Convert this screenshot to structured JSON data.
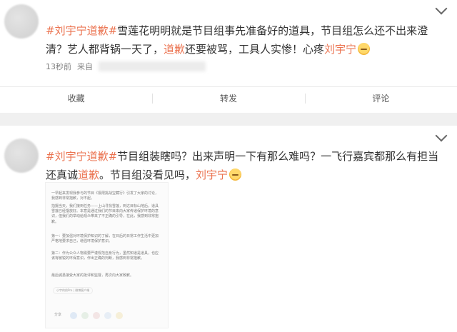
{
  "post1": {
    "text": [
      {
        "t": "#刘宇宁道歉#",
        "tag": true
      },
      {
        "t": "雪莲花明明就是节目组事先准备好的道具，节目组怎么还不出来澄清？艺人都背锅一天了，",
        "tag": false
      },
      {
        "t": "道歉",
        "tag": true
      },
      {
        "t": "还要被骂，工具人实惨！心疼",
        "tag": false
      },
      {
        "t": "刘宇宁",
        "tag": true
      }
    ],
    "time": "13秒前",
    "source_label": "来自",
    "actions": [
      "收藏",
      "转发",
      "评论"
    ]
  },
  "post2": {
    "text": [
      {
        "t": "#刘宇宁道歉#",
        "tag": true
      },
      {
        "t": "节目组装瞎吗？出来声明一下有那么难吗？一飞行嘉宾都那么有担当还真诚",
        "tag": false
      },
      {
        "t": "道歉",
        "tag": true
      },
      {
        "t": "。节目组没看见吗，",
        "tag": false
      },
      {
        "t": "刘宇宁",
        "tag": true
      }
    ],
    "screenshot": {
      "paragraphs": [
        "一早起来发现我参与的节目《极限挑战宝藏行》引发了大家的讨论，我感到非常抱歉，对不起。",
        "拍摄当天，我们接到任务——上山寻找雪莲，到达目标山地后，道具雪莲已经摆放好。本意是通过我们的节目来向大家传递保护环境的意识，但我们的举动给观众带来了不正确的引导，在此，我感到非常抱歉。",
        "第一：要加强对环境保护知识的了解，在日后的日常工作生活中更加严格地要求自己，增强环境保护意识。",
        "第二：作为公众人物需要严谨规范自身行为，虽然知道是道具，也应该有敏锐的环保意识，作出正确的判断，我感到非常抱歉。",
        "最后诚恳接受大家的批评和监督，再次向大家致歉。"
      ],
      "source": "小宇的前Pro | 微博客户端",
      "share_label": "分享"
    }
  }
}
